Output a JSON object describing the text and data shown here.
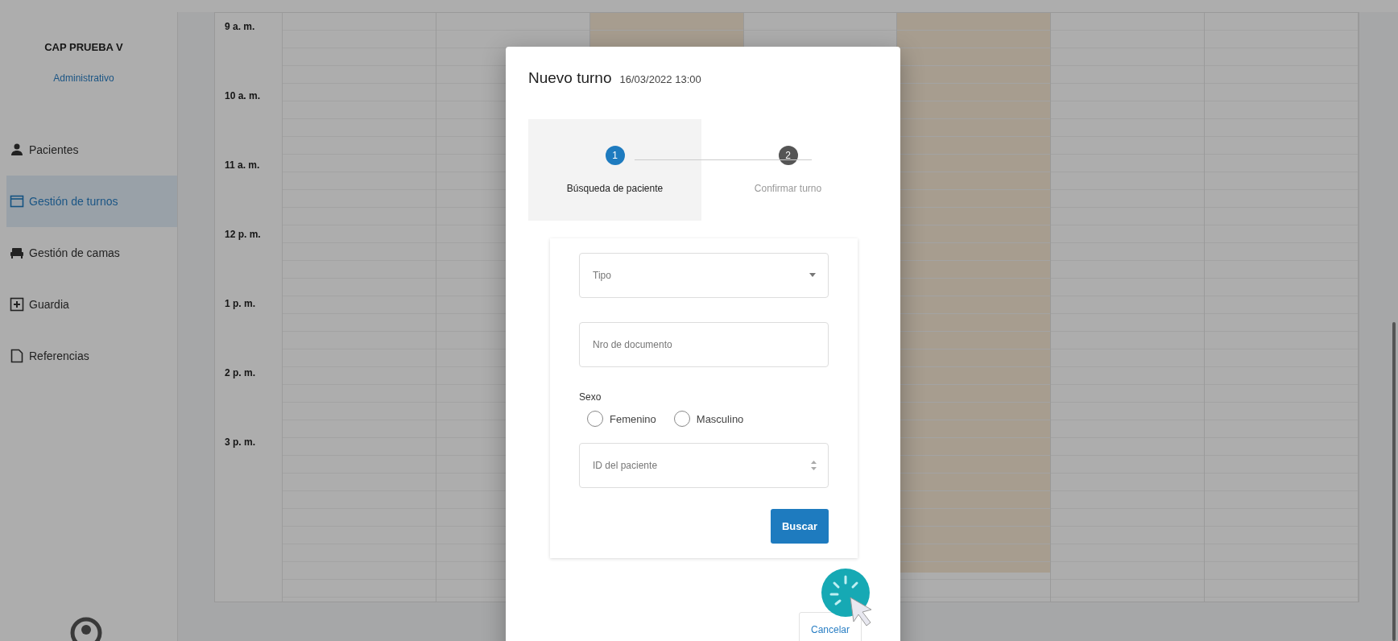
{
  "sidebar": {
    "institution": "CAP PRUEBA V",
    "role": "Administrativo",
    "items": [
      {
        "label": "Pacientes",
        "kind": "person",
        "selected": false
      },
      {
        "label": "Gestión de turnos",
        "kind": "calendar",
        "selected": true
      },
      {
        "label": "Gestión de camas",
        "kind": "bed",
        "selected": false
      },
      {
        "label": "Guardia",
        "kind": "plus",
        "selected": false
      },
      {
        "label": "Referencias",
        "kind": "document",
        "selected": false
      }
    ]
  },
  "calendar": {
    "hours": [
      "9 a. m.",
      "10 a. m.",
      "11 a. m.",
      "12 p. m.",
      "1 p. m.",
      "2 p. m.",
      "3 p. m."
    ],
    "days": [
      {
        "highlighted": false
      },
      {
        "highlighted": false
      },
      {
        "highlighted": true
      },
      {
        "highlighted": false
      },
      {
        "highlighted": true
      },
      {
        "highlighted": false
      },
      {
        "highlighted": false
      }
    ]
  },
  "dialog": {
    "title": "Nuevo turno",
    "datetime": "16/03/2022 13:00",
    "steps": [
      {
        "number": "1",
        "label": "Búsqueda de paciente",
        "selected": true
      },
      {
        "number": "2",
        "label": "Confirmar turno",
        "selected": false
      }
    ],
    "fields": [
      {
        "kind": "select",
        "placeholder": "Tipo"
      },
      {
        "kind": "text",
        "placeholder": "Nro de documento"
      },
      {
        "kind": "radio",
        "label": "Sexo",
        "options": [
          {
            "label": "Femenino",
            "selected": false
          },
          {
            "label": "Masculino",
            "selected": false
          }
        ]
      },
      {
        "kind": "number",
        "placeholder": "ID del paciente"
      }
    ],
    "search_button": "Buscar",
    "cancel_button": "Cancelar"
  }
}
